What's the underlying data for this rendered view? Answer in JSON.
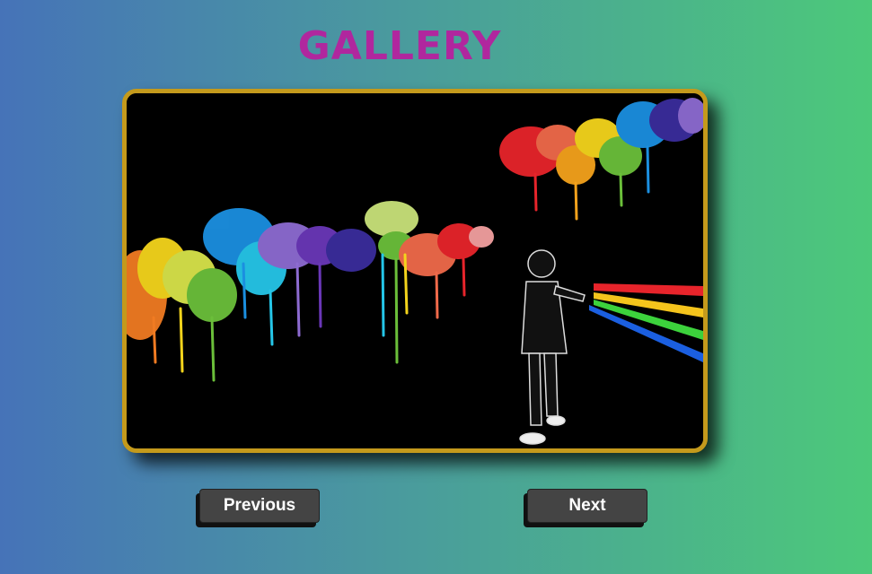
{
  "page": {
    "title": "GALLERY"
  },
  "gallery": {
    "image_alt": "graffiti artist spraying rainbow paint splatter"
  },
  "controls": {
    "previous_label": "Previous",
    "next_label": "Next"
  },
  "colors": {
    "title": "#b0279e",
    "frame_border": "#c49a1c",
    "button_bg": "#444444",
    "background_start": "#4673b8",
    "background_end": "#4cc97a"
  }
}
